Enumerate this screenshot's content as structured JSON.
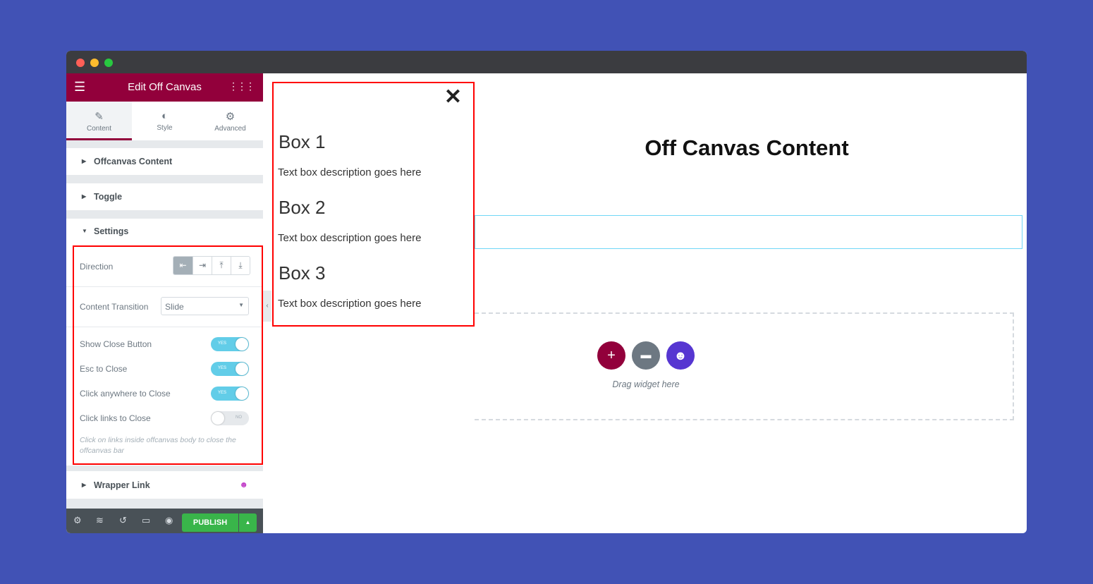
{
  "window": {
    "controls": [
      "close",
      "minimize",
      "maximize"
    ]
  },
  "sidebar": {
    "title": "Edit Off Canvas",
    "tabs": [
      {
        "label": "Content",
        "icon": "pencil-icon"
      },
      {
        "label": "Style",
        "icon": "half-circle-icon"
      },
      {
        "label": "Advanced",
        "icon": "gear-icon"
      }
    ],
    "sections": {
      "offcanvas_content": "Offcanvas Content",
      "toggle": "Toggle",
      "settings": "Settings",
      "wrapper_link": "Wrapper Link"
    },
    "settings": {
      "direction_label": "Direction",
      "direction_options": [
        "left",
        "right",
        "top",
        "bottom"
      ],
      "direction_selected": "left",
      "transition_label": "Content Transition",
      "transition_value": "Slide",
      "show_close": {
        "label": "Show Close Button",
        "state": "YES"
      },
      "esc_close": {
        "label": "Esc to Close",
        "state": "YES"
      },
      "click_anywhere": {
        "label": "Click anywhere to Close",
        "state": "YES"
      },
      "click_links": {
        "label": "Click links to Close",
        "state": "NO"
      },
      "help": "Click on links inside offcanvas body to close the offcanvas bar"
    },
    "footer": {
      "publish": "PUBLISH"
    }
  },
  "canvas": {
    "heading": "Off Canvas Content",
    "offcanvas": {
      "boxes": [
        {
          "title": "Box 1",
          "desc": "Text box description goes here"
        },
        {
          "title": "Box 2",
          "desc": "Text box description goes here"
        },
        {
          "title": "Box 3",
          "desc": "Text box description goes here"
        }
      ]
    },
    "drop_text": "Drag widget here"
  },
  "colors": {
    "brand": "#92003b",
    "toggle_on": "#62cde8",
    "publish": "#39b54a",
    "background": "#4152b5"
  }
}
